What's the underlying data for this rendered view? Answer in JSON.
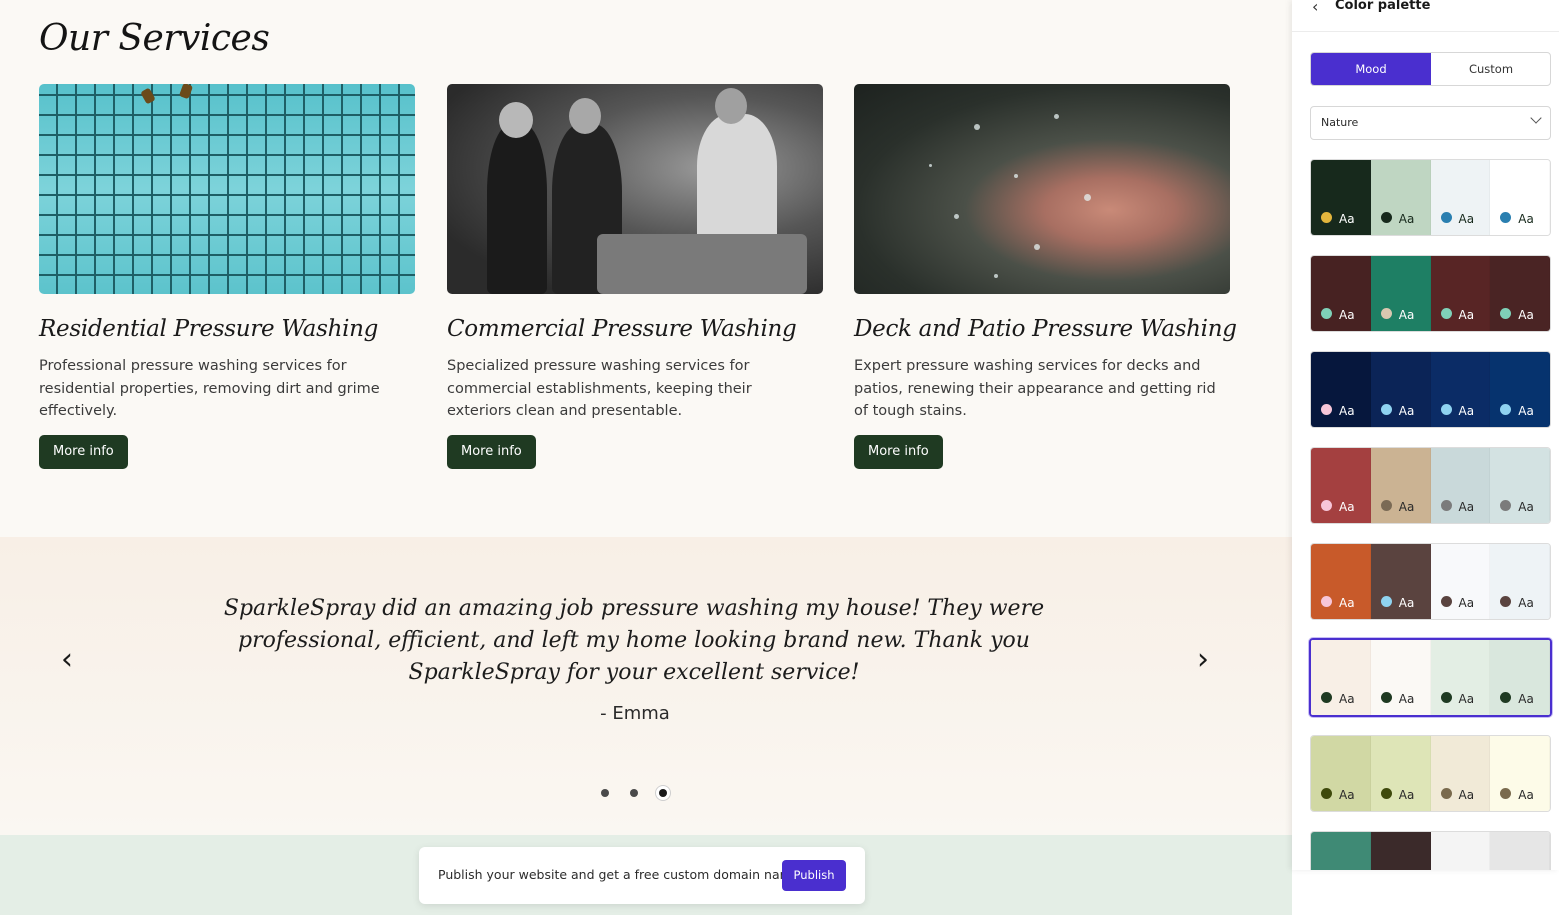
{
  "services": {
    "title": "Our Services",
    "cards": [
      {
        "title": "Residential Pressure Washing",
        "desc": "Professional pressure washing services for residential properties, removing dirt and grime effectively.",
        "button": "More info"
      },
      {
        "title": "Commercial Pressure Washing",
        "desc": "Specialized pressure washing services for commercial establishments, keeping their exteriors clean and presentable.",
        "button": "More info"
      },
      {
        "title": "Deck and Patio Pressure Washing",
        "desc": "Expert pressure washing services for decks and patios, renewing their appearance and getting rid of tough stains.",
        "button": "More info"
      }
    ]
  },
  "testimonial": {
    "quote": "SparkleSpray did an amazing job pressure washing my house! They were professional, efficient, and left my home looking brand new. Thank you SparkleSpray for your excellent service!",
    "author": "- Emma",
    "prev_icon": "chevron-left-icon",
    "next_icon": "chevron-right-icon",
    "dots": 3,
    "active_dot": 3
  },
  "publish": {
    "text": "Publish your website and get a free custom domain name",
    "button": "Publish"
  },
  "panel": {
    "title": "Color palette",
    "back_icon": "chevron-left-icon",
    "tabs": {
      "mood": "Mood",
      "custom": "Custom",
      "active": "Mood"
    },
    "select_value": "Nature",
    "aa": "Aa",
    "selected_index": 5,
    "palettes": [
      [
        {
          "bg": "#17291c",
          "dot": "#e3b53d",
          "fg": "#ffffff"
        },
        {
          "bg": "#bfd6c2",
          "dot": "#17291c",
          "fg": "#17291c"
        },
        {
          "bg": "#eef3f5",
          "dot": "#2a7fb0",
          "fg": "#17291c"
        },
        {
          "bg": "#ffffff",
          "dot": "#2a7fb0",
          "fg": "#17291c"
        }
      ],
      [
        {
          "bg": "#472222",
          "dot": "#7fd1b8",
          "fg": "#ffffff"
        },
        {
          "bg": "#1e7f64",
          "dot": "#d9c7b0",
          "fg": "#ffffff"
        },
        {
          "bg": "#582525",
          "dot": "#7fd1b8",
          "fg": "#ffffff"
        },
        {
          "bg": "#4a2424",
          "dot": "#7fd1b8",
          "fg": "#ffffff"
        }
      ],
      [
        {
          "bg": "#06173d",
          "dot": "#f7c6d8",
          "fg": "#ffffff"
        },
        {
          "bg": "#0b2457",
          "dot": "#8fd3f0",
          "fg": "#ffffff"
        },
        {
          "bg": "#0b2c66",
          "dot": "#8fd3f0",
          "fg": "#ffffff"
        },
        {
          "bg": "#06336e",
          "dot": "#8fd3f0",
          "fg": "#ffffff"
        }
      ],
      [
        {
          "bg": "#a44040",
          "dot": "#f7c6d8",
          "fg": "#ffffff"
        },
        {
          "bg": "#cbb393",
          "dot": "#7a6a55",
          "fg": "#2a2a2a"
        },
        {
          "bg": "#c9d9da",
          "dot": "#7b7b7b",
          "fg": "#2a2a2a"
        },
        {
          "bg": "#d3e2e2",
          "dot": "#7b7b7b",
          "fg": "#2a2a2a"
        }
      ],
      [
        {
          "bg": "#c85a2a",
          "dot": "#f7c6d8",
          "fg": "#ffffff"
        },
        {
          "bg": "#5a433f",
          "dot": "#8fd3f0",
          "fg": "#ffffff"
        },
        {
          "bg": "#f8f9fb",
          "dot": "#5a433f",
          "fg": "#2a2a2a"
        },
        {
          "bg": "#eef3f6",
          "dot": "#5a433f",
          "fg": "#2a2a2a"
        }
      ],
      [
        {
          "bg": "#f8efe6",
          "dot": "#1f3a22",
          "fg": "#2a2a2a"
        },
        {
          "bg": "#fbf9f5",
          "dot": "#1f3a22",
          "fg": "#2a2a2a"
        },
        {
          "bg": "#e3eee4",
          "dot": "#1f3a22",
          "fg": "#2a2a2a"
        },
        {
          "bg": "#d9e7dd",
          "dot": "#1f3a22",
          "fg": "#2a2a2a"
        }
      ],
      [
        {
          "bg": "#d1d8a4",
          "dot": "#3f4a0c",
          "fg": "#2a2a2a"
        },
        {
          "bg": "#dee5b7",
          "dot": "#3f4a0c",
          "fg": "#2a2a2a"
        },
        {
          "bg": "#f1ead7",
          "dot": "#7a6a4d",
          "fg": "#2a2a2a"
        },
        {
          "bg": "#fdfbe8",
          "dot": "#7a6a4d",
          "fg": "#2a2a2a"
        }
      ],
      [
        {
          "bg": "#3f8a75",
          "dot": "",
          "fg": "#ffffff"
        },
        {
          "bg": "#3b2a2a",
          "dot": "",
          "fg": "#ffffff"
        },
        {
          "bg": "#f4f4f4",
          "dot": "",
          "fg": "#2a2a2a"
        },
        {
          "bg": "#e6e6e6",
          "dot": "",
          "fg": "#2a2a2a"
        }
      ]
    ]
  },
  "colors": {
    "accent": "#4a2fcf",
    "button_dark_green": "#1f3a22",
    "site_bg": "#fbf9f5",
    "bottom_band": "#e4eee6"
  }
}
